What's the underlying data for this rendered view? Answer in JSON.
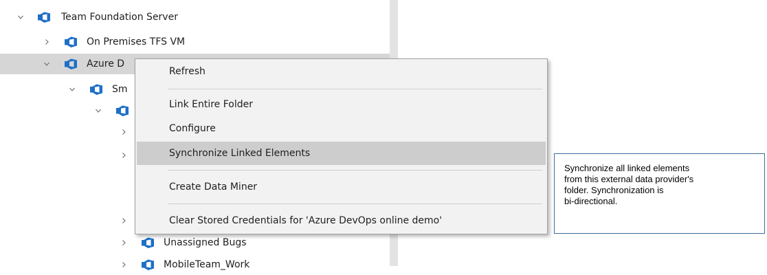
{
  "tree": {
    "items": [
      {
        "label": "Team Foundation Server",
        "expanded": true,
        "icon": "azure-devops-icon"
      },
      {
        "label": "On Premises TFS VM",
        "expanded": false,
        "icon": "azure-devops-icon"
      },
      {
        "label": "Azure D",
        "expanded": true,
        "icon": "azure-devops-icon",
        "selected": true
      },
      {
        "label": "Sm",
        "expanded": true,
        "icon": "azure-devops-icon"
      },
      {
        "label": "",
        "expanded": true,
        "icon": "azure-devops-icon"
      },
      {
        "label": "Unassigned Bugs",
        "expanded": false,
        "icon": "azure-devops-icon"
      },
      {
        "label": "MobileTeam_Work",
        "expanded": false,
        "icon": "azure-devops-icon"
      }
    ]
  },
  "context_menu": {
    "items": [
      {
        "label": "Refresh"
      },
      {
        "label": "Link Entire Folder"
      },
      {
        "label": "Configure"
      },
      {
        "label": "Synchronize Linked Elements",
        "highlighted": true
      },
      {
        "label": "Create Data Miner"
      },
      {
        "label": "Clear Stored Credentials for 'Azure DevOps online demo'"
      }
    ]
  },
  "tooltip": {
    "lines": [
      "Synchronize all linked elements",
      "from this external data provider's",
      "folder. Synchronization is",
      "bi-directional."
    ]
  },
  "colors": {
    "icon_blue": "#1e6fc7",
    "selected_row": "#d6d6d6",
    "menu_background": "#f2f2f2",
    "menu_highlight": "#cdcdcd",
    "tooltip_border": "#3f6b9c"
  }
}
